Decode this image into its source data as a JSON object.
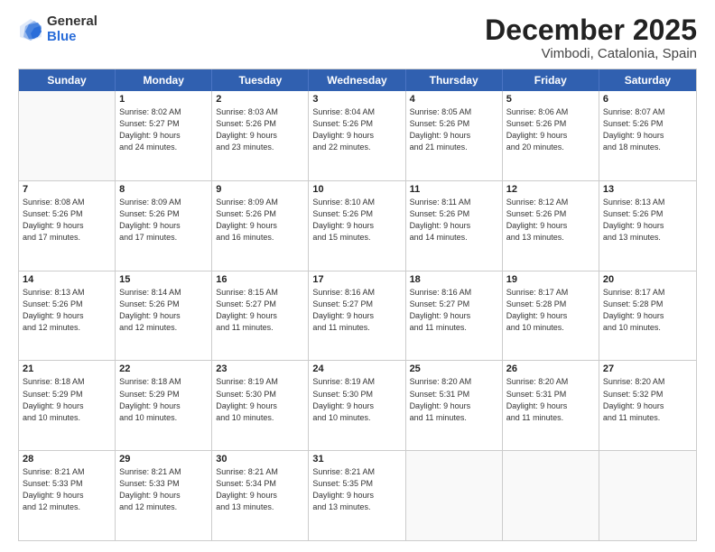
{
  "logo": {
    "general": "General",
    "blue": "Blue"
  },
  "title": "December 2025",
  "location": "Vimbodi, Catalonia, Spain",
  "headers": [
    "Sunday",
    "Monday",
    "Tuesday",
    "Wednesday",
    "Thursday",
    "Friday",
    "Saturday"
  ],
  "weeks": [
    [
      {
        "day": "",
        "info": ""
      },
      {
        "day": "1",
        "info": "Sunrise: 8:02 AM\nSunset: 5:27 PM\nDaylight: 9 hours\nand 24 minutes."
      },
      {
        "day": "2",
        "info": "Sunrise: 8:03 AM\nSunset: 5:26 PM\nDaylight: 9 hours\nand 23 minutes."
      },
      {
        "day": "3",
        "info": "Sunrise: 8:04 AM\nSunset: 5:26 PM\nDaylight: 9 hours\nand 22 minutes."
      },
      {
        "day": "4",
        "info": "Sunrise: 8:05 AM\nSunset: 5:26 PM\nDaylight: 9 hours\nand 21 minutes."
      },
      {
        "day": "5",
        "info": "Sunrise: 8:06 AM\nSunset: 5:26 PM\nDaylight: 9 hours\nand 20 minutes."
      },
      {
        "day": "6",
        "info": "Sunrise: 8:07 AM\nSunset: 5:26 PM\nDaylight: 9 hours\nand 18 minutes."
      }
    ],
    [
      {
        "day": "7",
        "info": "Sunrise: 8:08 AM\nSunset: 5:26 PM\nDaylight: 9 hours\nand 17 minutes."
      },
      {
        "day": "8",
        "info": "Sunrise: 8:09 AM\nSunset: 5:26 PM\nDaylight: 9 hours\nand 17 minutes."
      },
      {
        "day": "9",
        "info": "Sunrise: 8:09 AM\nSunset: 5:26 PM\nDaylight: 9 hours\nand 16 minutes."
      },
      {
        "day": "10",
        "info": "Sunrise: 8:10 AM\nSunset: 5:26 PM\nDaylight: 9 hours\nand 15 minutes."
      },
      {
        "day": "11",
        "info": "Sunrise: 8:11 AM\nSunset: 5:26 PM\nDaylight: 9 hours\nand 14 minutes."
      },
      {
        "day": "12",
        "info": "Sunrise: 8:12 AM\nSunset: 5:26 PM\nDaylight: 9 hours\nand 13 minutes."
      },
      {
        "day": "13",
        "info": "Sunrise: 8:13 AM\nSunset: 5:26 PM\nDaylight: 9 hours\nand 13 minutes."
      }
    ],
    [
      {
        "day": "14",
        "info": "Sunrise: 8:13 AM\nSunset: 5:26 PM\nDaylight: 9 hours\nand 12 minutes."
      },
      {
        "day": "15",
        "info": "Sunrise: 8:14 AM\nSunset: 5:26 PM\nDaylight: 9 hours\nand 12 minutes."
      },
      {
        "day": "16",
        "info": "Sunrise: 8:15 AM\nSunset: 5:27 PM\nDaylight: 9 hours\nand 11 minutes."
      },
      {
        "day": "17",
        "info": "Sunrise: 8:16 AM\nSunset: 5:27 PM\nDaylight: 9 hours\nand 11 minutes."
      },
      {
        "day": "18",
        "info": "Sunrise: 8:16 AM\nSunset: 5:27 PM\nDaylight: 9 hours\nand 11 minutes."
      },
      {
        "day": "19",
        "info": "Sunrise: 8:17 AM\nSunset: 5:28 PM\nDaylight: 9 hours\nand 10 minutes."
      },
      {
        "day": "20",
        "info": "Sunrise: 8:17 AM\nSunset: 5:28 PM\nDaylight: 9 hours\nand 10 minutes."
      }
    ],
    [
      {
        "day": "21",
        "info": "Sunrise: 8:18 AM\nSunset: 5:29 PM\nDaylight: 9 hours\nand 10 minutes."
      },
      {
        "day": "22",
        "info": "Sunrise: 8:18 AM\nSunset: 5:29 PM\nDaylight: 9 hours\nand 10 minutes."
      },
      {
        "day": "23",
        "info": "Sunrise: 8:19 AM\nSunset: 5:30 PM\nDaylight: 9 hours\nand 10 minutes."
      },
      {
        "day": "24",
        "info": "Sunrise: 8:19 AM\nSunset: 5:30 PM\nDaylight: 9 hours\nand 10 minutes."
      },
      {
        "day": "25",
        "info": "Sunrise: 8:20 AM\nSunset: 5:31 PM\nDaylight: 9 hours\nand 11 minutes."
      },
      {
        "day": "26",
        "info": "Sunrise: 8:20 AM\nSunset: 5:31 PM\nDaylight: 9 hours\nand 11 minutes."
      },
      {
        "day": "27",
        "info": "Sunrise: 8:20 AM\nSunset: 5:32 PM\nDaylight: 9 hours\nand 11 minutes."
      }
    ],
    [
      {
        "day": "28",
        "info": "Sunrise: 8:21 AM\nSunset: 5:33 PM\nDaylight: 9 hours\nand 12 minutes."
      },
      {
        "day": "29",
        "info": "Sunrise: 8:21 AM\nSunset: 5:33 PM\nDaylight: 9 hours\nand 12 minutes."
      },
      {
        "day": "30",
        "info": "Sunrise: 8:21 AM\nSunset: 5:34 PM\nDaylight: 9 hours\nand 13 minutes."
      },
      {
        "day": "31",
        "info": "Sunrise: 8:21 AM\nSunset: 5:35 PM\nDaylight: 9 hours\nand 13 minutes."
      },
      {
        "day": "",
        "info": ""
      },
      {
        "day": "",
        "info": ""
      },
      {
        "day": "",
        "info": ""
      }
    ]
  ]
}
